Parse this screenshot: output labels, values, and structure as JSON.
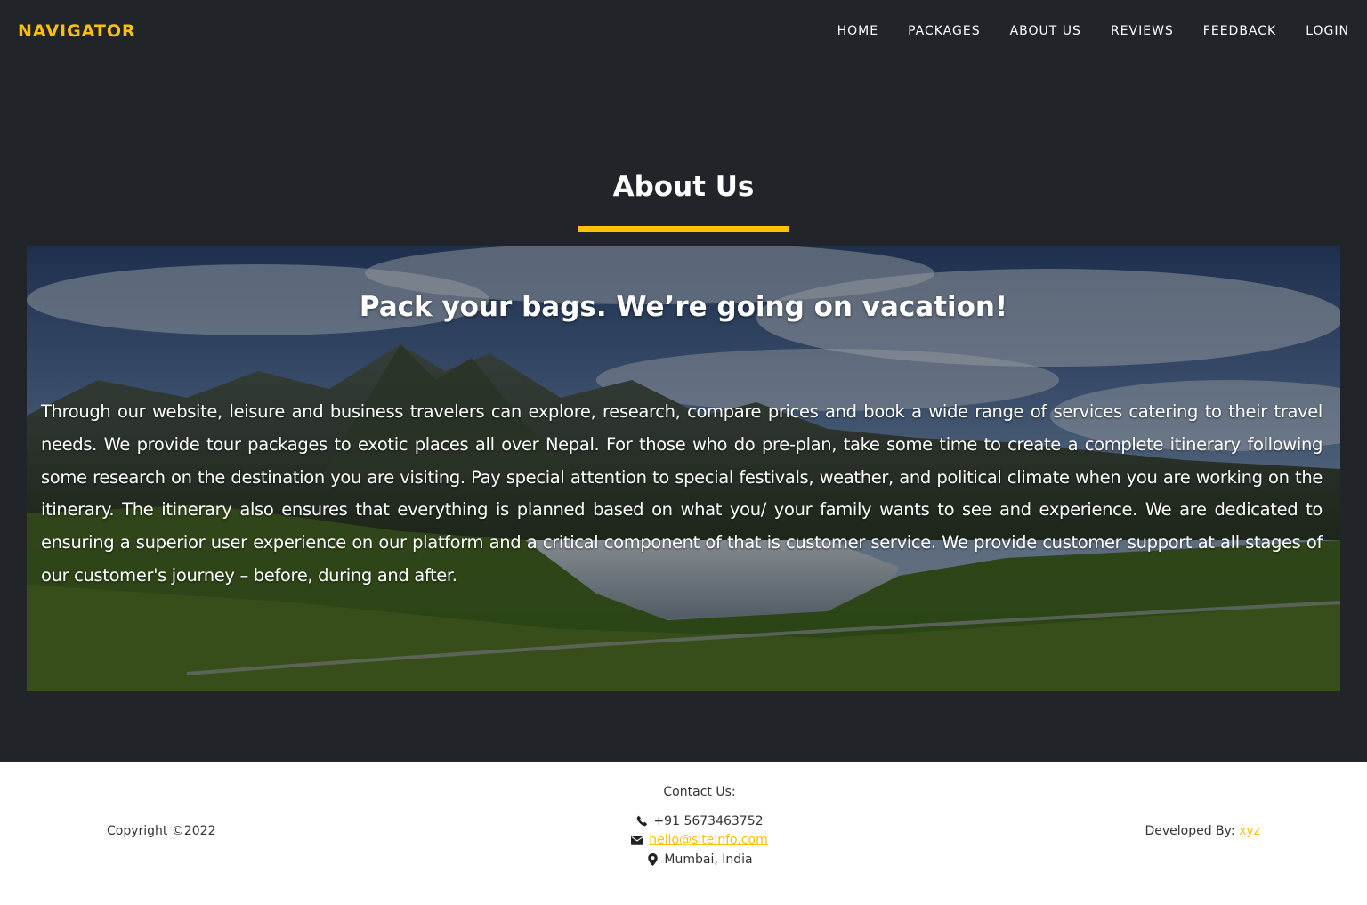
{
  "navbar": {
    "brand": "NAVIGATOR",
    "links": [
      "HOME",
      "PACKAGES",
      "ABOUT US",
      "REVIEWS",
      "FEEDBACK",
      "LOGIN"
    ]
  },
  "about": {
    "title": "About Us",
    "hero_heading": "Pack your bags. We’re going on vacation!",
    "hero_text": "Through our website, leisure and business travelers can explore, research, compare prices and book a wide range of services catering to their travel needs. We provide tour packages to exotic places all over Nepal. For those who do pre-plan, take some time to create a complete itinerary following some research on the destination you are visiting. Pay special attention to special festivals, weather, and political climate when you are working on the itinerary. The itinerary also ensures that everything is planned based on what you/ your family wants to see and experience. We are dedicated to ensuring a superior user experience on our platform and a critical component of that is customer service. We provide customer support at all stages of our customer's journey – before, during and after."
  },
  "footer": {
    "copyright": "Copyright ©2022",
    "contact_title": "Contact Us:",
    "phone": "+91 5673463752",
    "email": "hello@siteinfo.com",
    "location": "Mumbai, India",
    "developed_label": "Developed By:",
    "developer": "xyz"
  },
  "icons": {
    "phone": "phone-icon",
    "email": "envelope-icon",
    "location": "map-marker-icon"
  },
  "colors": {
    "accent": "#ffc107",
    "background": "#212529",
    "footer_bg": "#ffffff"
  }
}
